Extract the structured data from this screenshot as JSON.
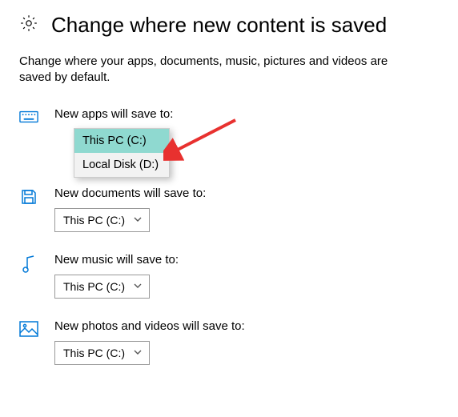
{
  "header": {
    "title": "Change where new content is saved"
  },
  "description": "Change where your apps, documents, music, pictures and videos are saved by default.",
  "dropdown_options": [
    {
      "label": "This PC (C:)",
      "selected": true
    },
    {
      "label": "Local Disk (D:)",
      "selected": false
    }
  ],
  "rows": {
    "apps": {
      "label": "New apps will save to:",
      "value": "This PC (C:)"
    },
    "documents": {
      "label": "New documents will save to:",
      "value": "This PC (C:)"
    },
    "music": {
      "label": "New music will save to:",
      "value": "This PC (C:)"
    },
    "photos": {
      "label": "New photos and videos will save to:",
      "value": "This PC (C:)"
    }
  },
  "colors": {
    "accent": "#0078d7",
    "dropdown_highlight": "#8fd9d0",
    "arrow": "#e8312f"
  }
}
